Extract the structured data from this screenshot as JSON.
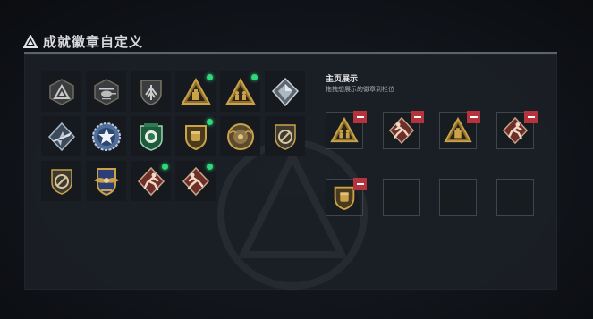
{
  "title": "成就徽章自定义",
  "showcase": {
    "heading": "主页展示",
    "hint": "拖拽想展示的徽章到栏位"
  },
  "badges": [
    {
      "icon": "triangle-emblem-icon",
      "new": false
    },
    {
      "icon": "helicopter-emblem-icon",
      "new": false
    },
    {
      "icon": "wings-shield-icon",
      "new": false
    },
    {
      "icon": "golden-triangle-icon",
      "new": true
    },
    {
      "icon": "golden-triangle-soldiers-icon",
      "new": true
    },
    {
      "icon": "silver-diamond-icon",
      "new": false
    },
    {
      "icon": "silver-fighter-jet-icon",
      "new": false
    },
    {
      "icon": "blue-star-badge-icon",
      "new": false
    },
    {
      "icon": "green-crest-badge-icon",
      "new": false
    },
    {
      "icon": "gold-fist-shield-icon",
      "new": true
    },
    {
      "icon": "gold-roundel-icon",
      "new": false
    },
    {
      "icon": "circle-slash-shield-icon",
      "new": false
    },
    {
      "icon": "circle-slash-shield-icon",
      "new": false
    },
    {
      "icon": "eagle-wings-medal-icon",
      "new": false
    },
    {
      "icon": "red-runner-icon",
      "new": true
    },
    {
      "icon": "red-sprinter-icon",
      "new": true
    }
  ],
  "slots": [
    {
      "icon": "golden-triangle-soldiers-icon",
      "filled": true
    },
    {
      "icon": "red-sprinter-icon",
      "filled": true
    },
    {
      "icon": "golden-triangle-icon",
      "filled": true
    },
    {
      "icon": "red-runner-icon",
      "filled": true
    },
    {
      "icon": "gold-fist-shield-icon",
      "filled": true
    },
    {
      "icon": "empty-slot",
      "filled": false
    },
    {
      "icon": "empty-slot",
      "filled": false
    },
    {
      "icon": "empty-slot",
      "filled": false
    }
  ],
  "colors": {
    "accent_green": "#2fd87a",
    "remove_red": "#b5333c",
    "gold": "#c9a24a"
  }
}
